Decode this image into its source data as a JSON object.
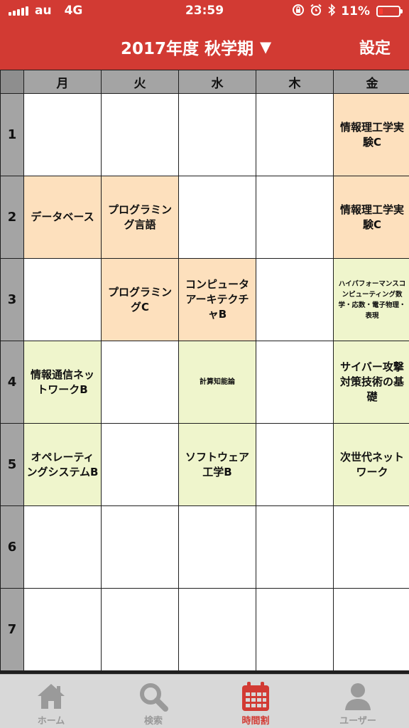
{
  "status_bar": {
    "carrier": "au",
    "network": "4G",
    "time": "23:59",
    "battery": "11%",
    "icons": [
      "signal-icon",
      "lock-rotation-icon",
      "alarm-icon",
      "bluetooth-icon",
      "battery-icon"
    ]
  },
  "header": {
    "title": "2017年度 秋学期",
    "dropdown_glyph": "▼",
    "settings_label": "設定"
  },
  "colors": {
    "accent": "#d23a33",
    "required_course": "#fde0bd",
    "elective_course": "#eff5cc"
  },
  "timetable": {
    "days": [
      "月",
      "火",
      "水",
      "木",
      "金"
    ],
    "periods": [
      "1",
      "2",
      "3",
      "4",
      "5",
      "6",
      "7"
    ],
    "rows": [
      [
        "",
        "",
        "",
        "",
        "情報理工学実験C"
      ],
      [
        "データベース",
        "プログラミング言語",
        "",
        "",
        "情報理工学実験C"
      ],
      [
        "",
        "プログラミングC",
        "コンピュータアーキテクチャB",
        "",
        "ハイパフォーマンスコンピューティング数学・応数・電子物理・表現"
      ],
      [
        "情報通信ネットワークB",
        "",
        "計算知能論",
        "",
        "サイバー攻撃対策技術の基礎"
      ],
      [
        "オペレーティングシステムB",
        "",
        "ソフトウェア工学B",
        "",
        "次世代ネットワーク"
      ],
      [
        "",
        "",
        "",
        "",
        ""
      ],
      [
        "",
        "",
        "",
        "",
        ""
      ]
    ]
  },
  "tabbar": {
    "tabs": [
      {
        "label": "ホーム",
        "icon": "home-icon"
      },
      {
        "label": "検索",
        "icon": "search-icon"
      },
      {
        "label": "時間割",
        "icon": "calendar-icon"
      },
      {
        "label": "ユーザー",
        "icon": "user-icon"
      }
    ],
    "active_tab": "時間割"
  }
}
